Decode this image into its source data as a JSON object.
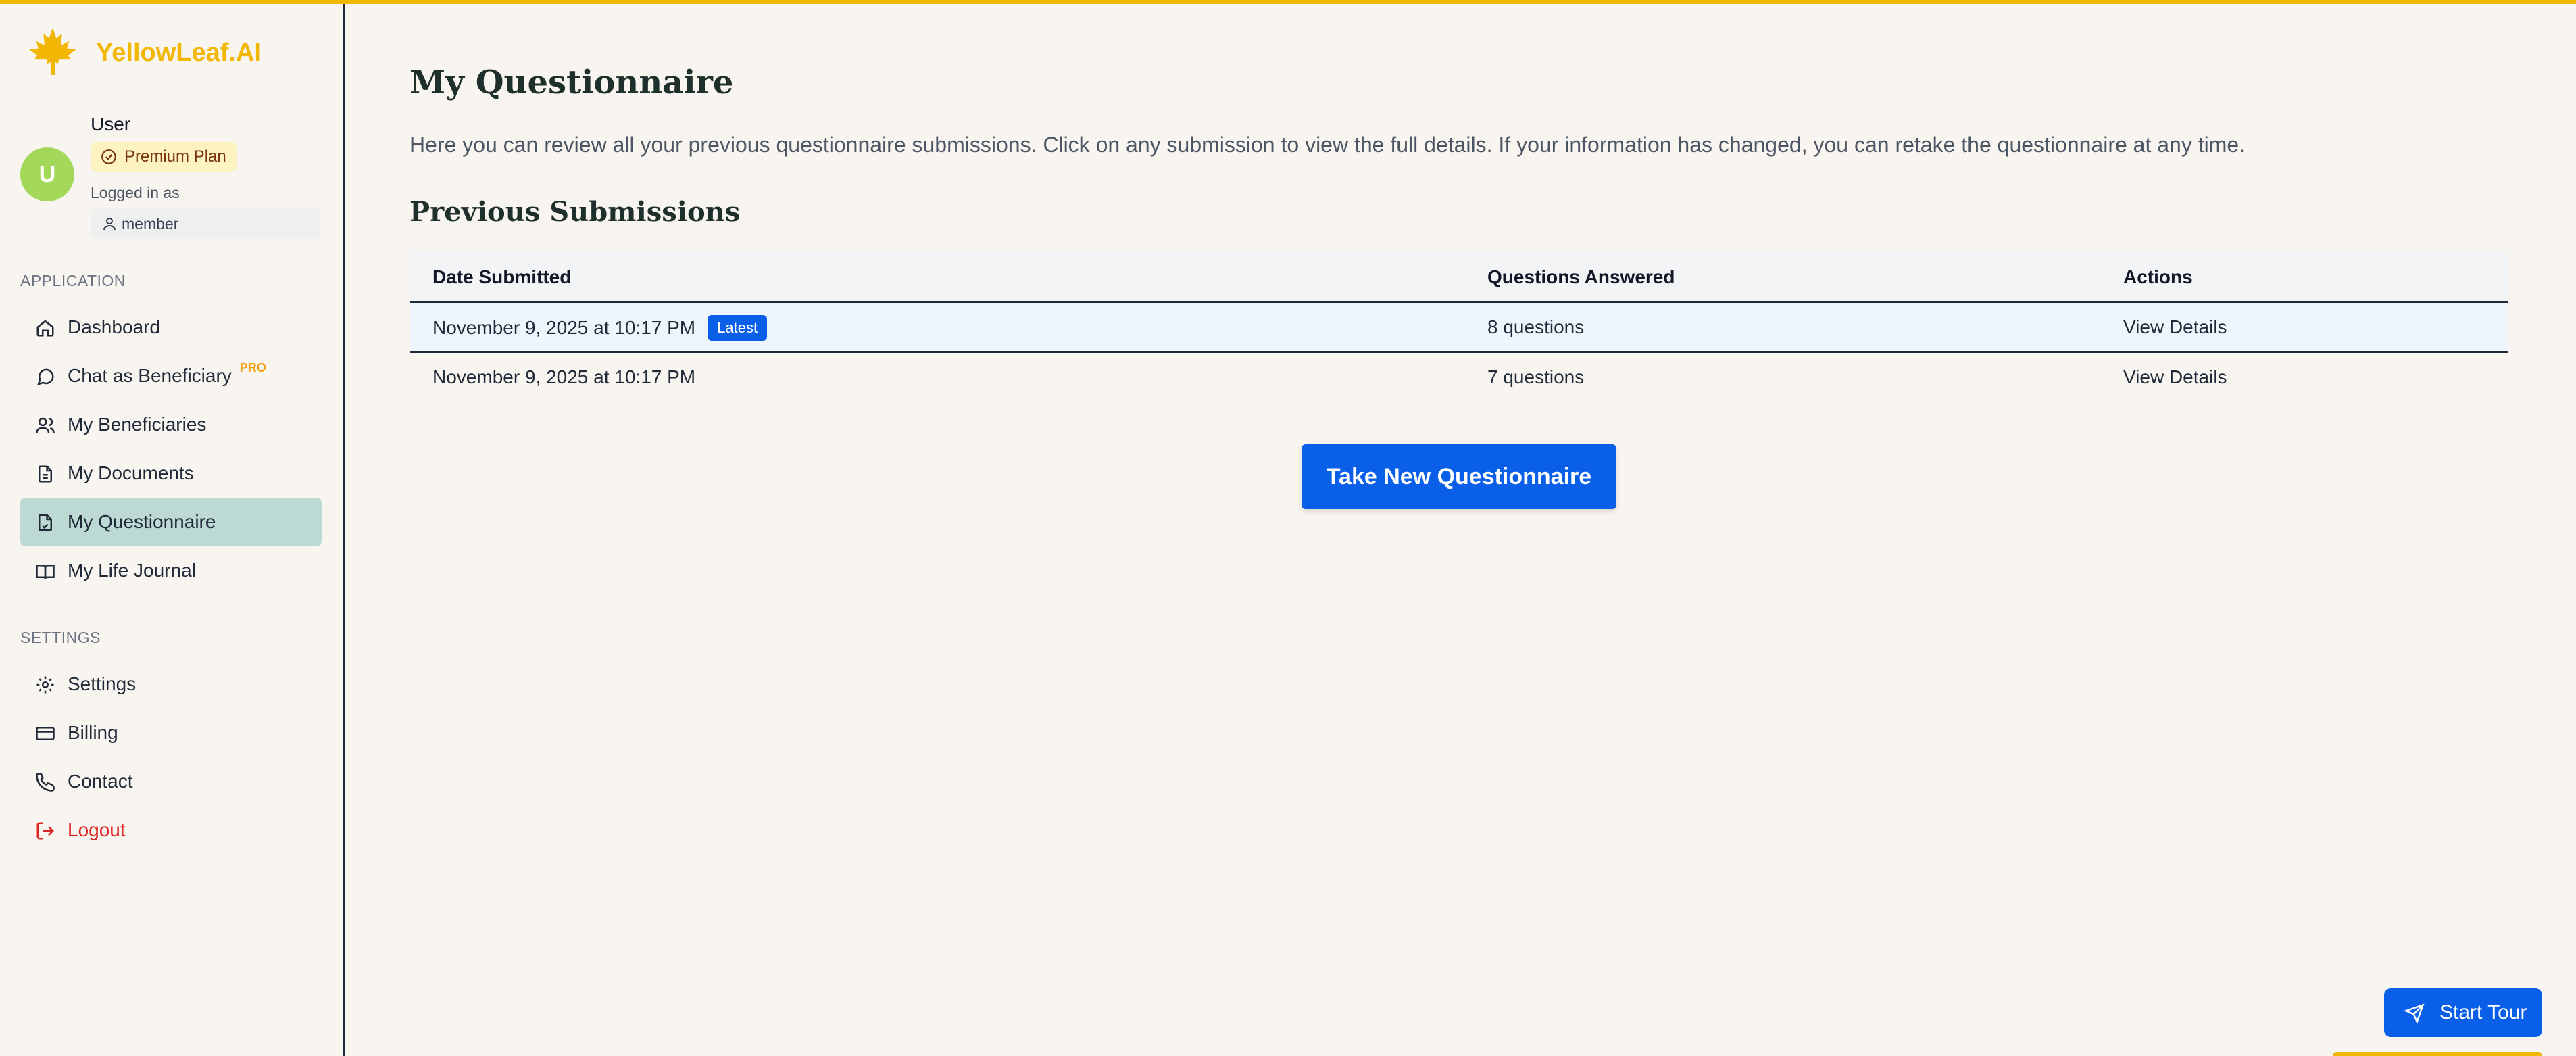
{
  "brand": {
    "name": "YellowLeaf.AI",
    "color": "#f2b705"
  },
  "user": {
    "initial": "U",
    "name": "User",
    "plan": "Premium Plan",
    "logged_in_label": "Logged in as",
    "role": "member"
  },
  "sidebar": {
    "application_label": "APPLICATION",
    "settings_label": "SETTINGS",
    "app_items": [
      {
        "label": "Dashboard",
        "icon": "home-icon"
      },
      {
        "label": "Chat as Beneficiary",
        "icon": "chat-icon",
        "tag": "PRO"
      },
      {
        "label": "My Beneficiaries",
        "icon": "users-icon"
      },
      {
        "label": "My Documents",
        "icon": "document-icon"
      },
      {
        "label": "My Questionnaire",
        "icon": "questionnaire-icon",
        "active": true
      },
      {
        "label": "My Life Journal",
        "icon": "book-icon"
      }
    ],
    "settings_items": [
      {
        "label": "Settings",
        "icon": "gear-icon"
      },
      {
        "label": "Billing",
        "icon": "credit-card-icon"
      },
      {
        "label": "Contact",
        "icon": "phone-icon"
      },
      {
        "label": "Logout",
        "icon": "logout-icon"
      }
    ]
  },
  "main": {
    "title": "My Questionnaire",
    "intro": "Here you can review all your previous questionnaire submissions. Click on any submission to view the full details. If your information has changed, you can retake the questionnaire at any time.",
    "submissions_title": "Previous Submissions",
    "table": {
      "headers": [
        "Date Submitted",
        "Questions Answered",
        "Actions"
      ],
      "rows": [
        {
          "date": "November 9, 2025 at 10:17 PM",
          "badge": "Latest",
          "answered": "8 questions",
          "action": "View Details"
        },
        {
          "date": "November 9, 2025 at 10:17 PM",
          "answered": "7 questions",
          "action": "View Details"
        }
      ]
    },
    "take_button": "Take New Questionnaire",
    "tour_button": "Start Tour"
  }
}
